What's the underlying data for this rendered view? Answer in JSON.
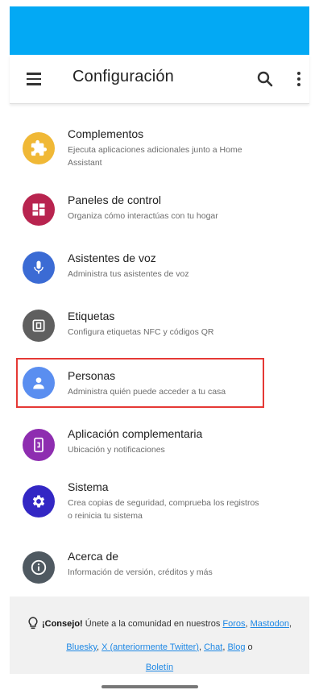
{
  "header": {
    "title": "Configuración",
    "menu_icon": "hamburger-icon",
    "search_icon": "search-icon",
    "more_icon": "more-vert-icon"
  },
  "colors": {
    "status_bar": "#03a9f4",
    "highlight_border": "#e53935",
    "link": "#1e88e5"
  },
  "items": [
    {
      "title": "Complementos",
      "subtitle": "Ejecuta aplicaciones adicionales junto a Home Assistant",
      "icon": "puzzle-icon",
      "color": "#f0b836"
    },
    {
      "title": "Paneles de control",
      "subtitle": "Organiza cómo interactúas con tu hogar",
      "icon": "dashboard-icon",
      "color": "#b8244f"
    },
    {
      "title": "Asistentes de voz",
      "subtitle": "Administra tus asistentes de voz",
      "icon": "microphone-icon",
      "color": "#3b6bd4"
    },
    {
      "title": "Etiquetas",
      "subtitle": "Configura etiquetas NFC y códigos QR",
      "icon": "nfc-tag-icon",
      "color": "#5f5f5f"
    },
    {
      "title": "Personas",
      "subtitle": "Administra quién puede acceder a tu casa",
      "icon": "person-icon",
      "color": "#5a8ef0",
      "highlighted": true
    },
    {
      "title": "Aplicación complementaria",
      "subtitle": "Ubicación y notificaciones",
      "icon": "cellphone-icon",
      "color": "#8e2db0"
    },
    {
      "title": "Sistema",
      "subtitle": "Crea copias de seguridad, comprueba los registros o reinicia tu sistema",
      "icon": "gear-icon",
      "color": "#3327c4"
    },
    {
      "title": "Acerca de",
      "subtitle": "Información de versión, créditos y más",
      "icon": "info-icon",
      "color": "#4f5961"
    }
  ],
  "tip": {
    "icon": "lightbulb-icon",
    "label": "¡Consejo!",
    "text": " Únete a la comunidad en nuestros ",
    "links": {
      "foros": "Foros",
      "mastodon": "Mastodon",
      "bluesky": "Bluesky",
      "x": "X (anteriormente Twitter)",
      "chat": "Chat",
      "blog": "Blog",
      "boletin": "Boletín"
    },
    "sep_comma": ", ",
    "sep_or": " o "
  }
}
